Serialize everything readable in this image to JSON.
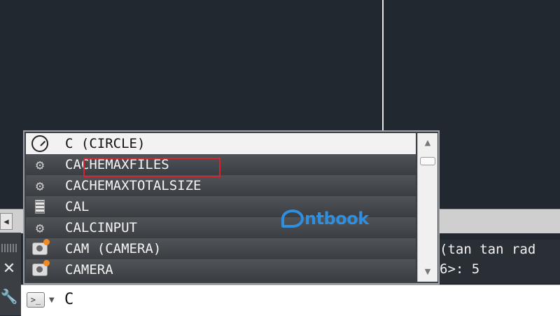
{
  "canvas": {
    "history_lines": [
      "(tan tan rad",
      "6>: 5"
    ]
  },
  "scrollbar": {
    "left_arrow": "◀"
  },
  "side": {
    "close_glyph": "✕",
    "tool_glyph": "🔧"
  },
  "command_bar": {
    "prompt_glyph": ">_",
    "dropdown_glyph": "▼",
    "input_value": "C"
  },
  "autocomplete": {
    "items": [
      {
        "label": "C (CIRCLE)",
        "icon": "circle-icon",
        "selected": true
      },
      {
        "label": "CACHEMAXFILES",
        "icon": "gear-icon",
        "highlighted": true
      },
      {
        "label": "CACHEMAXTOTALSIZE",
        "icon": "gear-icon"
      },
      {
        "label": "CAL",
        "icon": "calculator-icon"
      },
      {
        "label": "CALCINPUT",
        "icon": "gear-icon"
      },
      {
        "label": "CAM (CAMERA)",
        "icon": "camera-icon"
      },
      {
        "label": "CAMERA",
        "icon": "camera-icon"
      }
    ],
    "scroll_up": "▲",
    "scroll_down": "▼"
  },
  "watermark": {
    "text": "ntbook"
  },
  "colors": {
    "canvas_bg": "#212830",
    "highlight_border": "#d4252f",
    "watermark": "#2e8fe0"
  }
}
